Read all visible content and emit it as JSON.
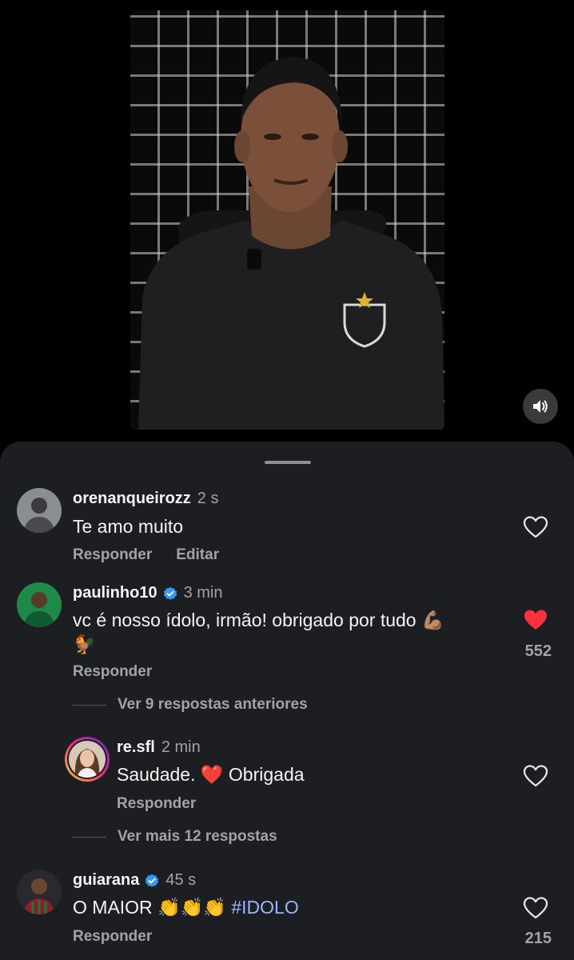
{
  "video": {
    "sound_icon": "speaker-icon"
  },
  "comments": [
    {
      "username": "orenanqueirozz",
      "time": "2 s",
      "verified": false,
      "text": "Te amo muito",
      "actions": [
        "Responder",
        "Editar"
      ],
      "liked": false,
      "like_count": ""
    },
    {
      "username": "paulinho10",
      "time": "3 min",
      "verified": true,
      "text_line1": "vc é nosso ídolo, irmão! obrigado por tudo 💪🏽",
      "text_line2": "🐓",
      "reply_label": "Responder",
      "liked": true,
      "like_count": "552",
      "view_previous_replies": "Ver 9 respostas anteriores"
    },
    {
      "username": "re.sfl",
      "time": "2 min",
      "verified": false,
      "text_before": "Saudade. ",
      "text_emoji": "❤️",
      "text_after": " Obrigada",
      "reply_label": "Responder",
      "liked": false,
      "view_more_replies": "Ver mais 12 respostas"
    },
    {
      "username": "guiarana",
      "time": "45 s",
      "verified": true,
      "text_before": "O MAIOR 👏👏👏 ",
      "hashtag": "#IDOLO",
      "reply_label": "Responder",
      "liked": false,
      "like_count": "215"
    }
  ],
  "colors": {
    "background": "#000000",
    "sheet": "#1c1e22",
    "secondary_text": "#a0a3a8",
    "verified_blue": "#3897f0",
    "like_red": "#ff3040",
    "hashtag": "#9ab4ff"
  }
}
